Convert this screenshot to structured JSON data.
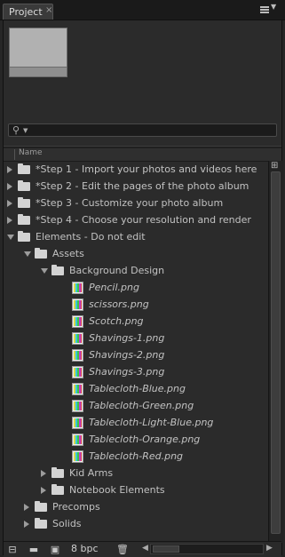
{
  "tab": {
    "title": "Project",
    "close": "×"
  },
  "header": {
    "column_name": "Name"
  },
  "search": {
    "placeholder": ""
  },
  "items": [
    {
      "label": "*Step 1 - Import your photos and videos here",
      "type": "folder",
      "depth": 0,
      "expanded": false
    },
    {
      "label": "*Step 2 - Edit the pages of the photo album",
      "type": "folder",
      "depth": 0,
      "expanded": false
    },
    {
      "label": "*Step 3 - Customize your photo album",
      "type": "folder",
      "depth": 0,
      "expanded": false
    },
    {
      "label": "*Step 4 - Choose your resolution and render",
      "type": "folder",
      "depth": 0,
      "expanded": false
    },
    {
      "label": "Elements - Do not edit",
      "type": "folder",
      "depth": 0,
      "expanded": true
    },
    {
      "label": "Assets",
      "type": "folder",
      "depth": 1,
      "expanded": true
    },
    {
      "label": "Background Design",
      "type": "folder",
      "depth": 2,
      "expanded": true
    },
    {
      "label": "Pencil.png",
      "type": "file",
      "depth": 3
    },
    {
      "label": "scissors.png",
      "type": "file",
      "depth": 3
    },
    {
      "label": "Scotch.png",
      "type": "file",
      "depth": 3
    },
    {
      "label": "Shavings-1.png",
      "type": "file",
      "depth": 3
    },
    {
      "label": "Shavings-2.png",
      "type": "file",
      "depth": 3
    },
    {
      "label": "Shavings-3.png",
      "type": "file",
      "depth": 3
    },
    {
      "label": "Tablecloth-Blue.png",
      "type": "file",
      "depth": 3
    },
    {
      "label": "Tablecloth-Green.png",
      "type": "file",
      "depth": 3
    },
    {
      "label": "Tablecloth-Light-Blue.png",
      "type": "file",
      "depth": 3
    },
    {
      "label": "Tablecloth-Orange.png",
      "type": "file",
      "depth": 3
    },
    {
      "label": "Tablecloth-Red.png",
      "type": "file",
      "depth": 3
    },
    {
      "label": "Kid Arms",
      "type": "folder",
      "depth": 2,
      "expanded": false
    },
    {
      "label": "Notebook Elements",
      "type": "folder",
      "depth": 2,
      "expanded": false
    },
    {
      "label": "Precomps",
      "type": "folder",
      "depth": 1,
      "expanded": false
    },
    {
      "label": "Solids",
      "type": "folder",
      "depth": 1,
      "expanded": false
    }
  ],
  "footer": {
    "bpc": "8 bpc"
  },
  "icons": {
    "folder": "folder-icon",
    "file": "footage-file-icon",
    "search": "search-icon",
    "menu": "panel-menu-icon",
    "trash": "trash-icon"
  },
  "colors": {
    "background": "#2b2b2b",
    "text": "#c2c2c2",
    "folder": "#d3d3d3"
  }
}
